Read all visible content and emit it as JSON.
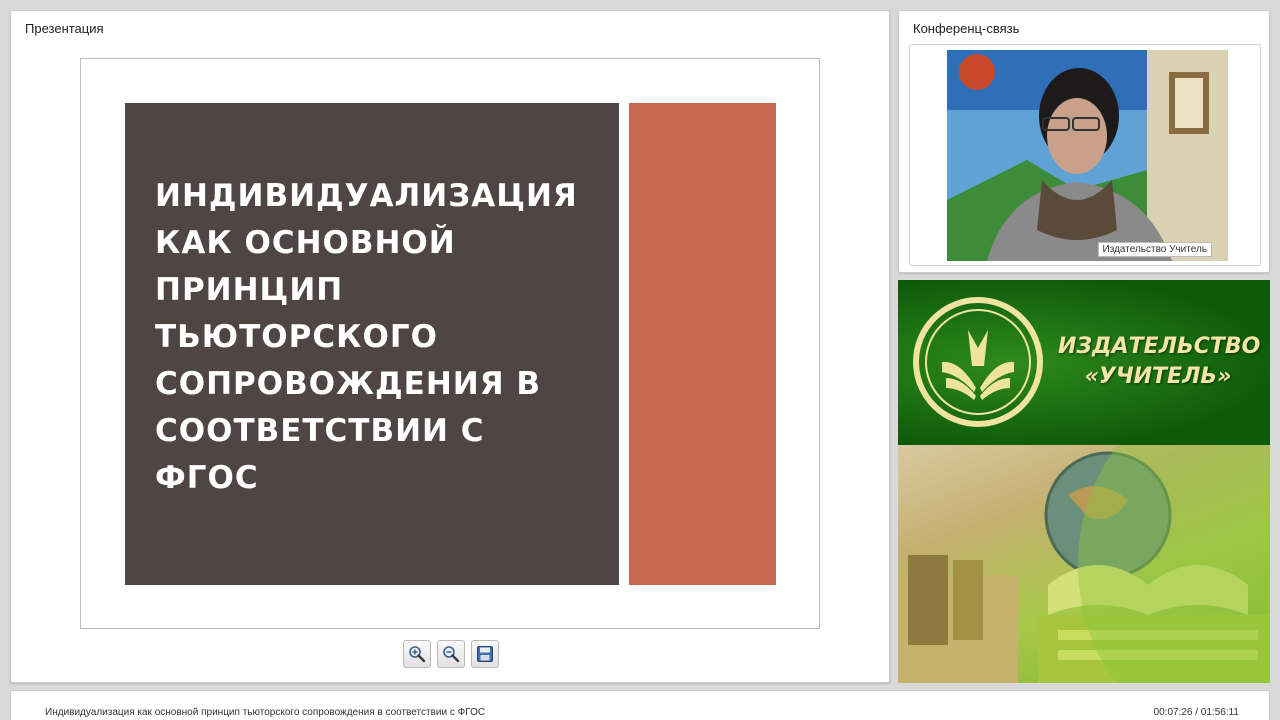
{
  "presentation": {
    "panel_title": "Презентация",
    "slide_title": "Индивидуализация как основной принцип тьюторского сопровождения в соответствии с ФГОС",
    "colors": {
      "slide_dark": "#4f4544",
      "slide_accent": "#c56951"
    },
    "toolbar": [
      {
        "icon": "zoom-in-icon"
      },
      {
        "icon": "zoom-out-icon"
      },
      {
        "icon": "save-icon"
      }
    ]
  },
  "conference": {
    "panel_title": "Конференц-связь",
    "participant_name": "Издательство Учитель"
  },
  "banner": {
    "publisher_line1": "ИЗДАТЕЛЬСТВО",
    "publisher_line2": "«УЧИТЕЛЬ»",
    "colors": {
      "green": "#0d5a0a",
      "text": "#f2e5a6"
    }
  },
  "footer": {
    "title": "Индивидуализация как основной принцип тьюторского сопровождения в соответствии с ФГОС",
    "time": "00:07:26 / 01:56:11"
  }
}
